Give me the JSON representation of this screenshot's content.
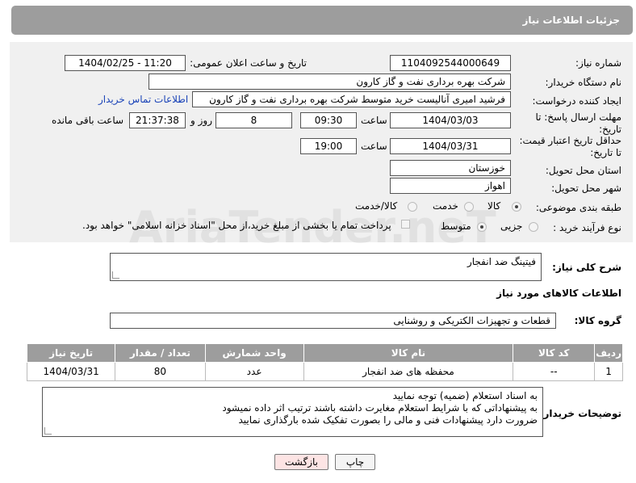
{
  "header": {
    "title": "جزئیات اطلاعات نیاز"
  },
  "form": {
    "need_number": {
      "label": "شماره نیاز:",
      "value": "1104092544000649"
    },
    "announce_datetime": {
      "label": "تاریخ و ساعت اعلان عمومی:",
      "value": "1404/02/25 - 11:20"
    },
    "buyer_org": {
      "label": "نام دستگاه خریدار:",
      "value": "شرکت بهره برداری نفت و گاز کارون"
    },
    "creator": {
      "label": "ایجاد کننده درخواست:",
      "value": "فرشید امیری آنالیست خرید متوسط شرکت بهره برداری نفت و گاز کارون",
      "contact_link": "اطلاعات تماس خریدار"
    },
    "reply_deadline": {
      "label_line1": "مهلت ارسال پاسخ: تا",
      "label_line2": "تاریخ:",
      "date": "1404/03/03",
      "time_label": "ساعت",
      "time": "09:30",
      "days": "8",
      "days_label": "روز و",
      "remaining": "21:37:38",
      "remaining_label": "ساعت باقی مانده"
    },
    "price_validity": {
      "label_line1": "حداقل تاریخ اعتبار قیمت:",
      "label_line2": "تا تاریخ:",
      "date": "1404/03/31",
      "time_label": "ساعت",
      "time": "19:00"
    },
    "province": {
      "label": "استان محل تحویل:",
      "value": "خوزستان"
    },
    "city": {
      "label": "شهر محل تحویل:",
      "value": "اهواز"
    },
    "category": {
      "label": "طبقه بندی موضوعی:",
      "options": [
        "کالا",
        "خدمت",
        "کالا/خدمت"
      ],
      "selected": "کالا"
    },
    "purchase_type": {
      "label": "نوع فرآیند خرید :",
      "options": [
        "جزیی",
        "متوسط"
      ],
      "selected": "متوسط",
      "note": "پرداخت تمام یا بخشی از مبلغ خرید،از محل \"اسناد خزانه اسلامی\" خواهد بود."
    }
  },
  "description": {
    "label": "شرح کلی نیاز:",
    "value": "فیتینگ ضد انفجار"
  },
  "goods_section": {
    "title": "اطلاعات کالاهای مورد نیاز",
    "group_label": "گروه کالا:",
    "group_value": "قطعات و تجهیزات الکتریکی و روشنایی"
  },
  "items_table": {
    "headers": [
      "ردیف",
      "کد کالا",
      "نام کالا",
      "واحد شمارش",
      "تعداد / مقدار",
      "تاریخ نیاز"
    ],
    "rows": [
      [
        "1",
        "--",
        "محفظه های ضد انفجار",
        "عدد",
        "80",
        "1404/03/31"
      ]
    ]
  },
  "buyer_notes": {
    "label": "توضیحات خریدار:",
    "lines": [
      "به اسناد استعلام (ضمیه) توجه نمایید",
      "به پیشنهاداتی که با شرایط استعلام مغایرت داشته باشند ترتیب اثر داده نمیشود",
      "ضرورت دارد پیشنهادات فنی و مالی را بصورت تفکیک شده بارگذاری نمایید"
    ]
  },
  "buttons": {
    "print": "چاپ",
    "back": "بازگشت"
  },
  "colors": {
    "header_bg": "#9d9d9d",
    "panel_bg": "#f0f0f0",
    "link": "#1a43b8",
    "back_btn": "#fde4e4"
  }
}
